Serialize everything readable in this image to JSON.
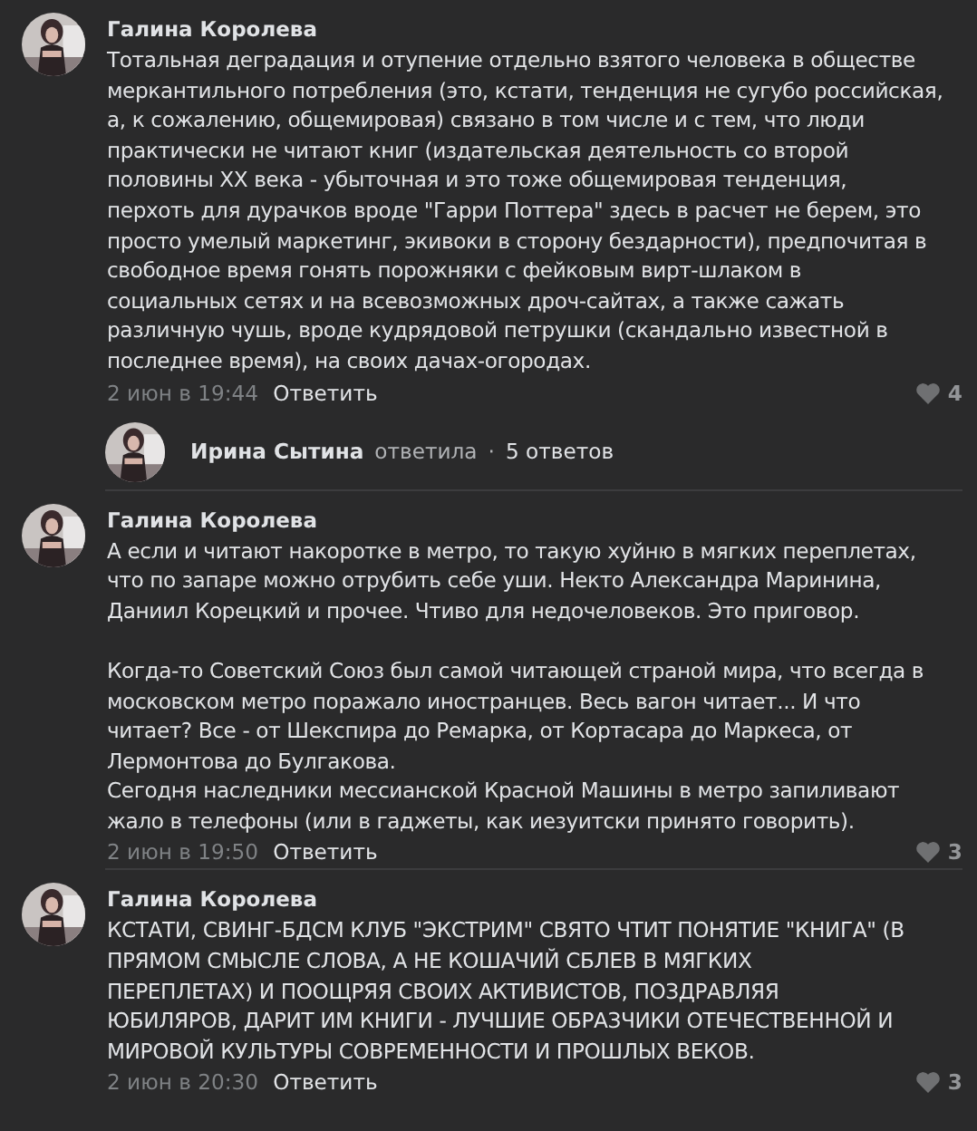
{
  "comments": [
    {
      "author": "Галина Королева",
      "text": "Тотальная деградация и отупение отдельно взятого человека в обществе\nмеркантильного потребления (это, кстати, тенденция не сугубо российская,\nа, к сожалению, общемировая) связано в том числе и с тем, что люди\nпрактически не читают книг (издательская деятельность со второй\nполовины XX века - убыточная и это тоже общемировая тенденция,\nперхоть для дурачков вроде \"Гарри Поттера\" здесь в расчет не берем, это\nпросто умелый маркетинг, экивоки в сторону бездарности), предпочитая в\nсвободное время гонять порожняки с фейковым вирт-шлаком в\nсоциальных сетях и на всевозможных дроч-сайтах, а также сажать\nразличную чушь, вроде кудрядовой петрушки (скандально известной в\nпоследнее время), на своих дачах-огородах.",
      "date": "2 июн в 19:44",
      "reply": "Ответить",
      "likes": "4",
      "replies_summary": {
        "author": "Ирина Сытина",
        "verb": "ответила",
        "separator": "·",
        "count": "5 ответов"
      }
    },
    {
      "author": "Галина Королева",
      "text": "А если и читают накоротке в метро, то такую хуйню в мягких переплетах,\nчто по запаре можно отрубить себе уши. Некто Александра Маринина,\nДаниил Корецкий и прочее. Чтиво для недочеловеков. Это приговор.\n\nКогда-то Советский Союз был самой читающей страной мира, что всегда в\nмосковском метро поражало иностранцев. Весь вагон читает... И что\nчитает? Все - от Шекспира до Ремарка, от Кортасара до Маркеса, от\nЛермонтова до Булгакова.\nСегодня наследники мессианской Красной Машины в метро запиливают\nжало в телефоны (или в гаджеты, как иезуитски принято говорить).",
      "date": "2 июн в 19:50",
      "reply": "Ответить",
      "likes": "3"
    },
    {
      "author": "Галина Королева",
      "text": "КСТАТИ, СВИНГ-БДСМ КЛУБ \"ЭКСТРИМ\" СВЯТО ЧТИТ ПОНЯТИЕ \"КНИГА\" (В\nПРЯМОМ СМЫСЛЕ СЛОВА, А НЕ КОШАЧИЙ СБЛЕВ В МЯГКИХ\nПЕРЕПЛЕТАХ) И ПООЩРЯЯ СВОИХ АКТИВИСТОВ, ПОЗДРАВЛЯЯ\nЮБИЛЯРОВ, ДАРИТ ИМ КНИГИ - ЛУЧШИЕ ОБРАЗЧИКИ ОТЕЧЕСТВЕННОЙ И\nМИРОВОЙ КУЛЬТУРЫ СОВРЕМЕННОСТИ И ПРОШЛЫХ ВЕКОВ.",
      "date": "2 июн в 20:30",
      "reply": "Ответить",
      "likes": "3"
    }
  ]
}
